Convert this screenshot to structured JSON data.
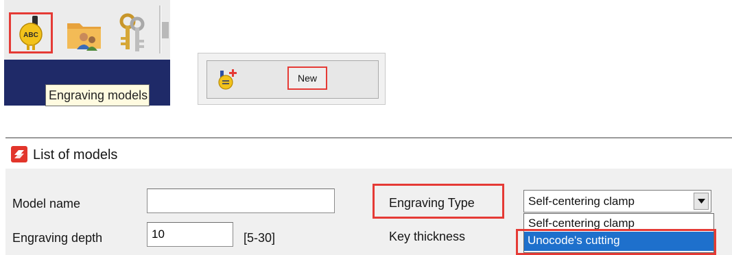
{
  "toolbar": {
    "engrave_icon_text": "ABC",
    "tooltip": "Engraving models",
    "icons": [
      "engraving-models-icon",
      "customers-folder-icon",
      "keys-icon"
    ]
  },
  "new_panel": {
    "new_label": "New",
    "icon": "new-model-icon"
  },
  "window": {
    "title": "List of models",
    "icon": "app-logo-icon"
  },
  "form": {
    "model_name_label": "Model name",
    "model_name_value": "",
    "engraving_depth_label": "Engraving depth",
    "engraving_depth_value": "10",
    "engraving_depth_range": "[5-30]",
    "engraving_type_label": "Engraving Type",
    "key_thickness_label": "Key thickness",
    "engraving_type_selected": "Self-centering clamp",
    "engraving_type_options": [
      "Self-centering clamp",
      "Unocode's cutting"
    ]
  },
  "colors": {
    "highlight": "#e53a35",
    "tooltip_bar": "#1f2a68",
    "selected_option": "#1e70cc"
  }
}
